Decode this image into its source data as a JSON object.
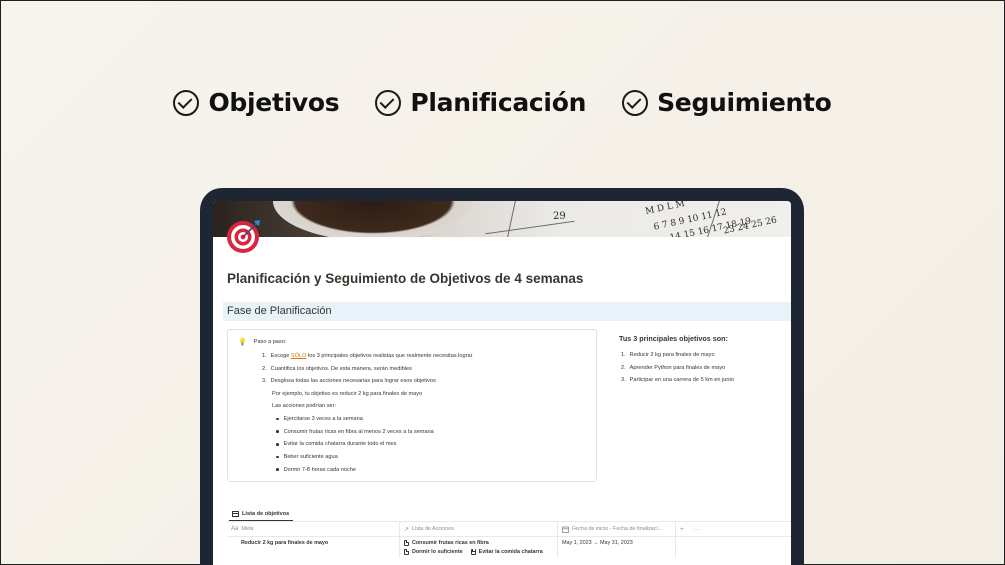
{
  "features": [
    {
      "label": "Objetivos",
      "icon": "check-circle-icon"
    },
    {
      "label": "Planificación",
      "icon": "check-circle-icon"
    },
    {
      "label": "Seguimiento",
      "icon": "check-circle-icon"
    }
  ],
  "cover": {
    "calendar_text_1": "29",
    "calendar_text_2": "M D L M",
    "calendar_text_3": "6 7 8 9 10 11 12",
    "calendar_text_4": "14 15 16 17 18 19",
    "calendar_text_5": "23 24 25 26"
  },
  "page": {
    "title": "Planificación y Seguimiento de Objetivos de 4 semanas",
    "section_heading": "Fase de Planificación"
  },
  "callout": {
    "header": "Paso a paso:",
    "steps": [
      {
        "num": "1.",
        "before": "Escoge ",
        "highlight": "SÓLO",
        "after": " los 3 principales objetivos realistas que realmente necesitas lograr"
      },
      {
        "num": "2.",
        "text": "Cuantifica los objetivos. De esta manera, serán medibles"
      },
      {
        "num": "3.",
        "text": "Desglosa todas las acciones necesarias para lograr esos objetivos"
      }
    ],
    "example": "Por ejemplo, tu objetivo es reducir 2 kg para finales de mayo",
    "actions_intro": "Las acciones podrían ser:",
    "bullets": [
      "Ejercitarse 3 veces a la semana",
      "Consumir frutas ricas en fibra al menos 2 veces a la semana",
      "Evitar la comida chatarra durante todo el mes",
      "Beber suficiente agua",
      "Dormir 7-8 horas cada noche"
    ]
  },
  "goals": {
    "title": "Tus 3 principales objetivos son:",
    "items": [
      {
        "num": "1.",
        "text": "Reducir 2 kg para finales de mayo"
      },
      {
        "num": "2.",
        "text": "Aprender Python para finales de mayo"
      },
      {
        "num": "3.",
        "text": "Participar en una carrera de 5 km en junio"
      }
    ]
  },
  "database": {
    "tab_label": "Lista de objetivos",
    "columns": [
      {
        "icon": "Aa",
        "label": "Meta"
      },
      {
        "icon": "↗",
        "label": "Lista de Acciones"
      },
      {
        "icon": "calendar-icon",
        "label": "Fecha de inicio - Fecha de finalizaci..."
      }
    ],
    "add_column": "+",
    "more_options": "···",
    "rows": [
      {
        "name": "Reducir 2 kg para finales de mayo",
        "actions": [
          [
            "Consumir frutas ricas en fibra"
          ],
          [
            "Dormir lo suficiente",
            "Evitar la comida chatarra"
          ]
        ],
        "dates": "May 1, 2023 → May 31, 2023"
      }
    ]
  }
}
